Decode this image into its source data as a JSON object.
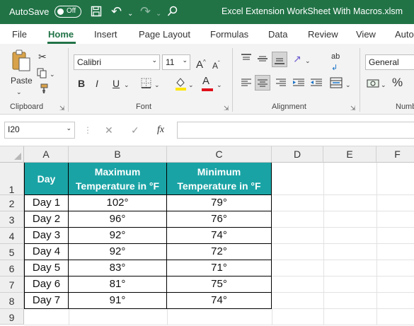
{
  "title_bar": {
    "autosave_label": "AutoSave",
    "autosave_state": "Off",
    "file_title": "Excel Extension WorkSheet With Macros.xlsm"
  },
  "tabs": [
    "File",
    "Home",
    "Insert",
    "Page Layout",
    "Formulas",
    "Data",
    "Review",
    "View",
    "Auto"
  ],
  "ribbon": {
    "paste_label": "Paste",
    "clipboard_label": "Clipboard",
    "font_name": "Calibri",
    "font_size": "11",
    "bold": "B",
    "italic": "I",
    "underline": "U",
    "grow_font": "A",
    "shrink_font": "A",
    "font_color_letter": "A",
    "font_label": "Font",
    "alignment_label": "Alignment",
    "number_format": "General",
    "percent": "%",
    "number_label": "Numb",
    "wrap_glyph": "ab",
    "colors": {
      "font_color": "#e0101a",
      "fill_color": "#ffe600",
      "accent": "#217346"
    }
  },
  "formula_bar": {
    "name_box": "I20",
    "cancel": "✕",
    "enter": "✓",
    "fx": "fx",
    "formula": ""
  },
  "columns": [
    "A",
    "B",
    "C",
    "D",
    "E",
    "F"
  ],
  "rows": [
    "1",
    "2",
    "3",
    "4",
    "5",
    "6",
    "7",
    "8",
    "9"
  ],
  "table": {
    "headers": [
      "Day",
      "Maximum Temperature in °F",
      "Minimum Temperature in °F"
    ],
    "header_color": "#1aa3a5",
    "data": [
      [
        "Day 1",
        "102°",
        "79°"
      ],
      [
        "Day 2",
        "96°",
        "76°"
      ],
      [
        "Day 3",
        "92°",
        "74°"
      ],
      [
        "Day 4",
        "92°",
        "72°"
      ],
      [
        "Day 5",
        "83°",
        "71°"
      ],
      [
        "Day 6",
        "81°",
        "75°"
      ],
      [
        "Day 7",
        "91°",
        "74°"
      ]
    ]
  }
}
